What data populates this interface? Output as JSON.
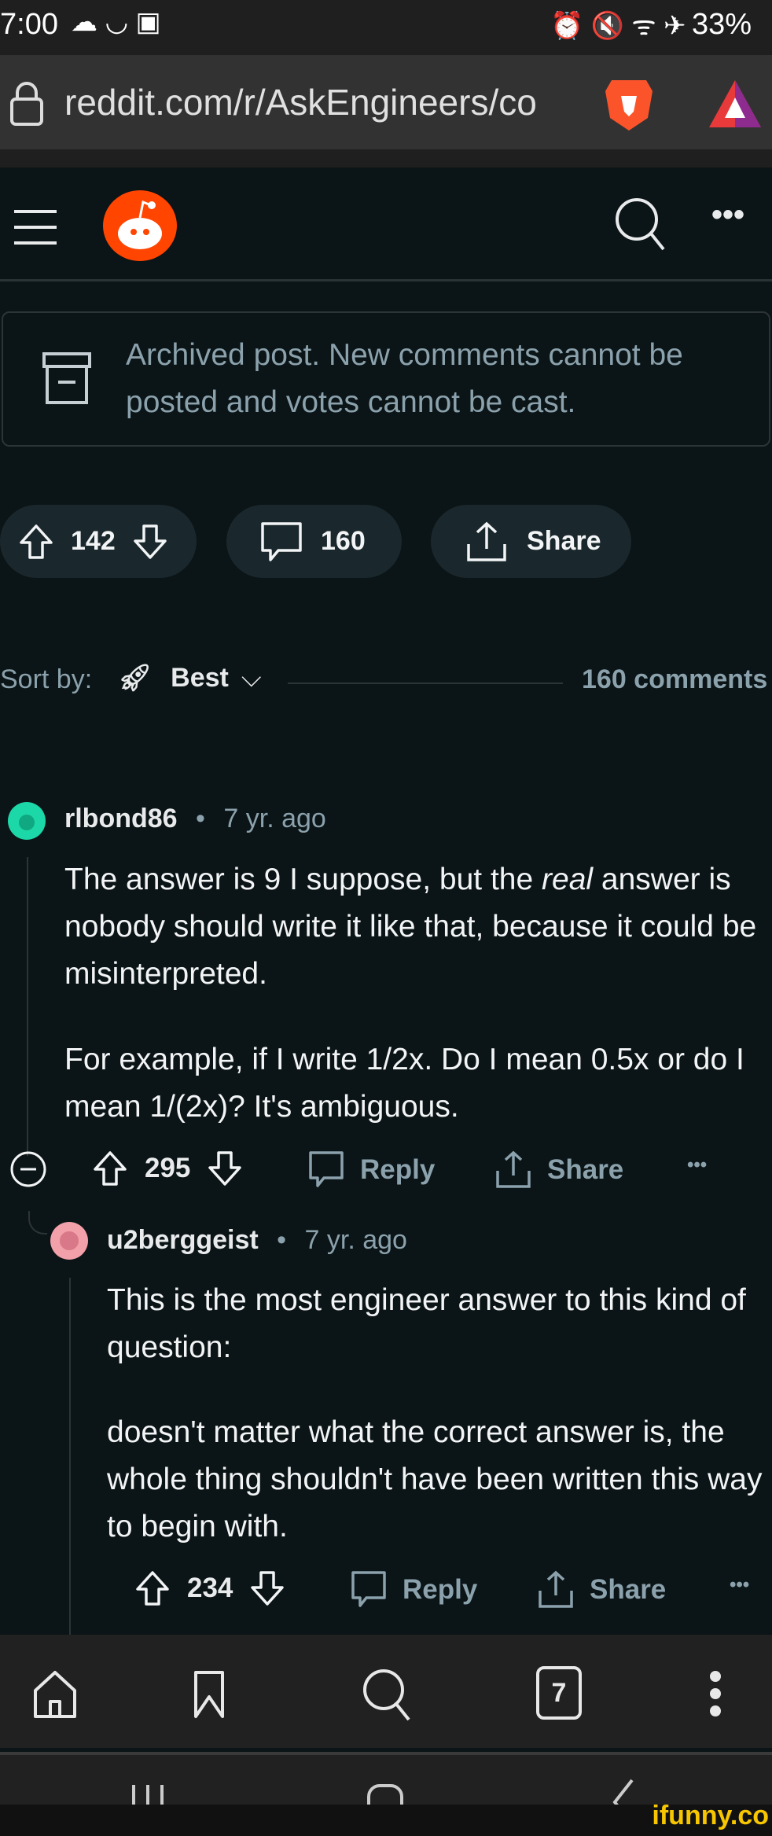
{
  "status_bar": {
    "time": "7:00",
    "battery": "33%"
  },
  "browser": {
    "url": "reddit.com/r/AskEngineers/co",
    "tab_count": "7"
  },
  "archived_notice": "Archived post. New comments cannot be posted and votes cannot be cast.",
  "post_actions": {
    "votes": "142",
    "comments": "160",
    "share": "Share"
  },
  "sort": {
    "label": "Sort by:",
    "value": "Best",
    "comment_count": "160 comments"
  },
  "comments": [
    {
      "author": "rlbond86",
      "age": "7 yr. ago",
      "p1_before": "The answer is 9 I suppose, but the ",
      "p1_em": "real",
      "p1_after": " answer is nobody should write it like that, because it could be misinterpreted.",
      "p2": "For example, if I write 1/2x. Do I mean 0.5x or do I mean 1/(2x)? It's ambiguous.",
      "votes": "295",
      "reply": "Reply",
      "share": "Share"
    },
    {
      "author": "u2berggeist",
      "age": "7 yr. ago",
      "p1": "This is the most engineer answer to this kind of question:",
      "p2": "doesn't matter what the correct answer is, the whole thing shouldn't have been written this way to begin with.",
      "votes": "234",
      "reply": "Reply",
      "share": "Share"
    }
  ],
  "watermark": "ifunny.co",
  "colors": {
    "reddit_orange": "#ff4500",
    "background": "#0b1416",
    "action_grey": "#8ba2ad"
  }
}
